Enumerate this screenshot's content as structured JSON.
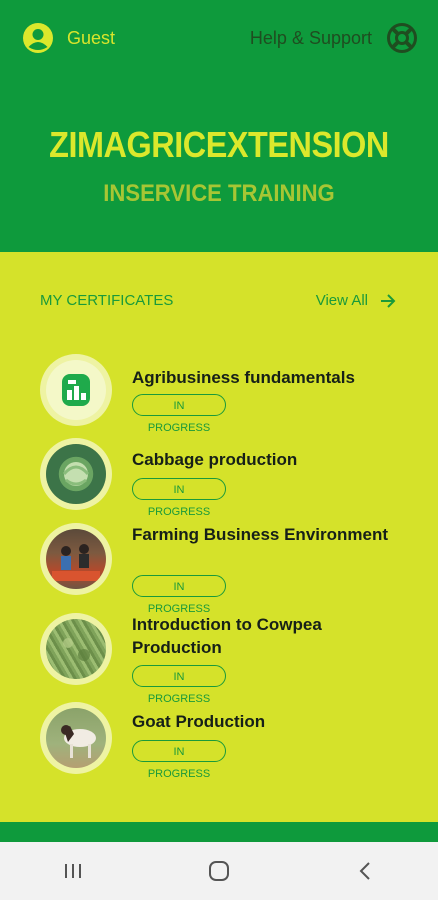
{
  "header": {
    "user_label": "Guest",
    "help_label": "Help & Support",
    "title": "ZIMAGRICEXTENSION",
    "subtitle": "INSERVICE TRAINING"
  },
  "certificates": {
    "section_title": "MY CERTIFICATES",
    "view_all_label": "View All",
    "items": [
      {
        "title": "Agribusiness fundamentals",
        "status": "IN PROGRESS"
      },
      {
        "title": "Cabbage production",
        "status": "IN PROGRESS"
      },
      {
        "title": "Farming Business Environment",
        "status": "IN PROGRESS"
      },
      {
        "title": "Introduction to Cowpea Production",
        "status": "IN PROGRESS"
      },
      {
        "title": "Goat Production",
        "status": "IN PROGRESS"
      }
    ]
  },
  "colors": {
    "header_green": "#0e9a3c",
    "lime_background": "#d5e22a",
    "accent_green": "#1a9a3a"
  }
}
